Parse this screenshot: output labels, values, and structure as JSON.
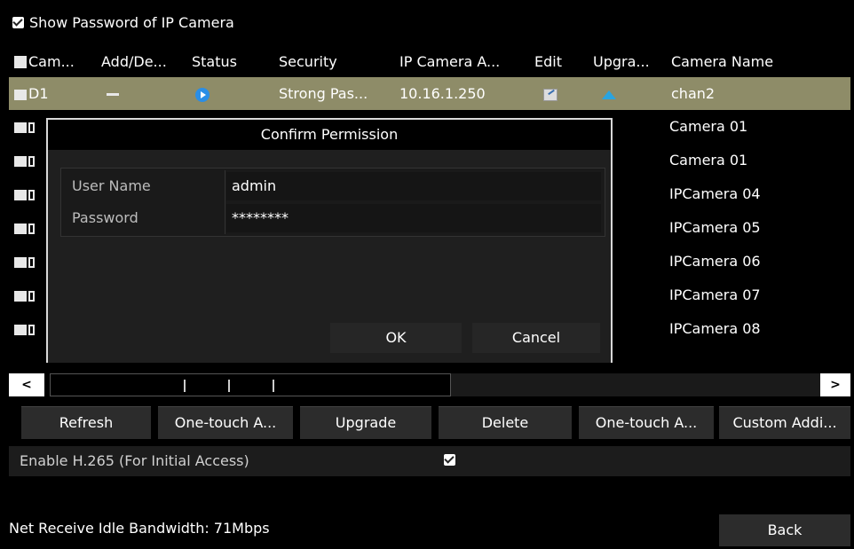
{
  "show_password": {
    "label": "Show Password of IP Camera",
    "checked": true
  },
  "table": {
    "columns": [
      "Cam...",
      "Add/De...",
      "Status",
      "Security",
      "IP Camera A...",
      "Edit",
      "Upgra...",
      "Camera Name"
    ],
    "rows": [
      {
        "cam": "D1",
        "security": "Strong Pas...",
        "ip": "10.16.1.250",
        "name": "chan2",
        "selected": true
      },
      {
        "cam": "D",
        "name": "Camera 01"
      },
      {
        "cam": "D",
        "name": "Camera 01"
      },
      {
        "cam": "D",
        "name": "IPCamera 04"
      },
      {
        "cam": "D",
        "name": "IPCamera 05"
      },
      {
        "cam": "D",
        "name": "IPCamera 06"
      },
      {
        "cam": "D",
        "name": "IPCamera 07"
      },
      {
        "cam": "D",
        "name": "IPCamera 08"
      }
    ]
  },
  "scroll": {
    "left": "<",
    "right": ">"
  },
  "buttons": {
    "refresh": "Refresh",
    "one_touch_a1": "One-touch A...",
    "upgrade": "Upgrade",
    "delete": "Delete",
    "one_touch_a2": "One-touch A...",
    "custom_add": "Custom Addi..."
  },
  "h265": {
    "label": "Enable H.265 (For Initial Access)",
    "checked": true
  },
  "bandwidth": "Net Receive Idle Bandwidth: 71Mbps",
  "back": "Back",
  "dialog": {
    "title": "Confirm Permission",
    "user_label": "User Name",
    "user_value": "admin",
    "password_label": "Password",
    "password_value": "********",
    "ok": "OK",
    "cancel": "Cancel"
  },
  "colors": {
    "selected_row": "#8e8c68",
    "status_icon": "#2a8ee6"
  }
}
